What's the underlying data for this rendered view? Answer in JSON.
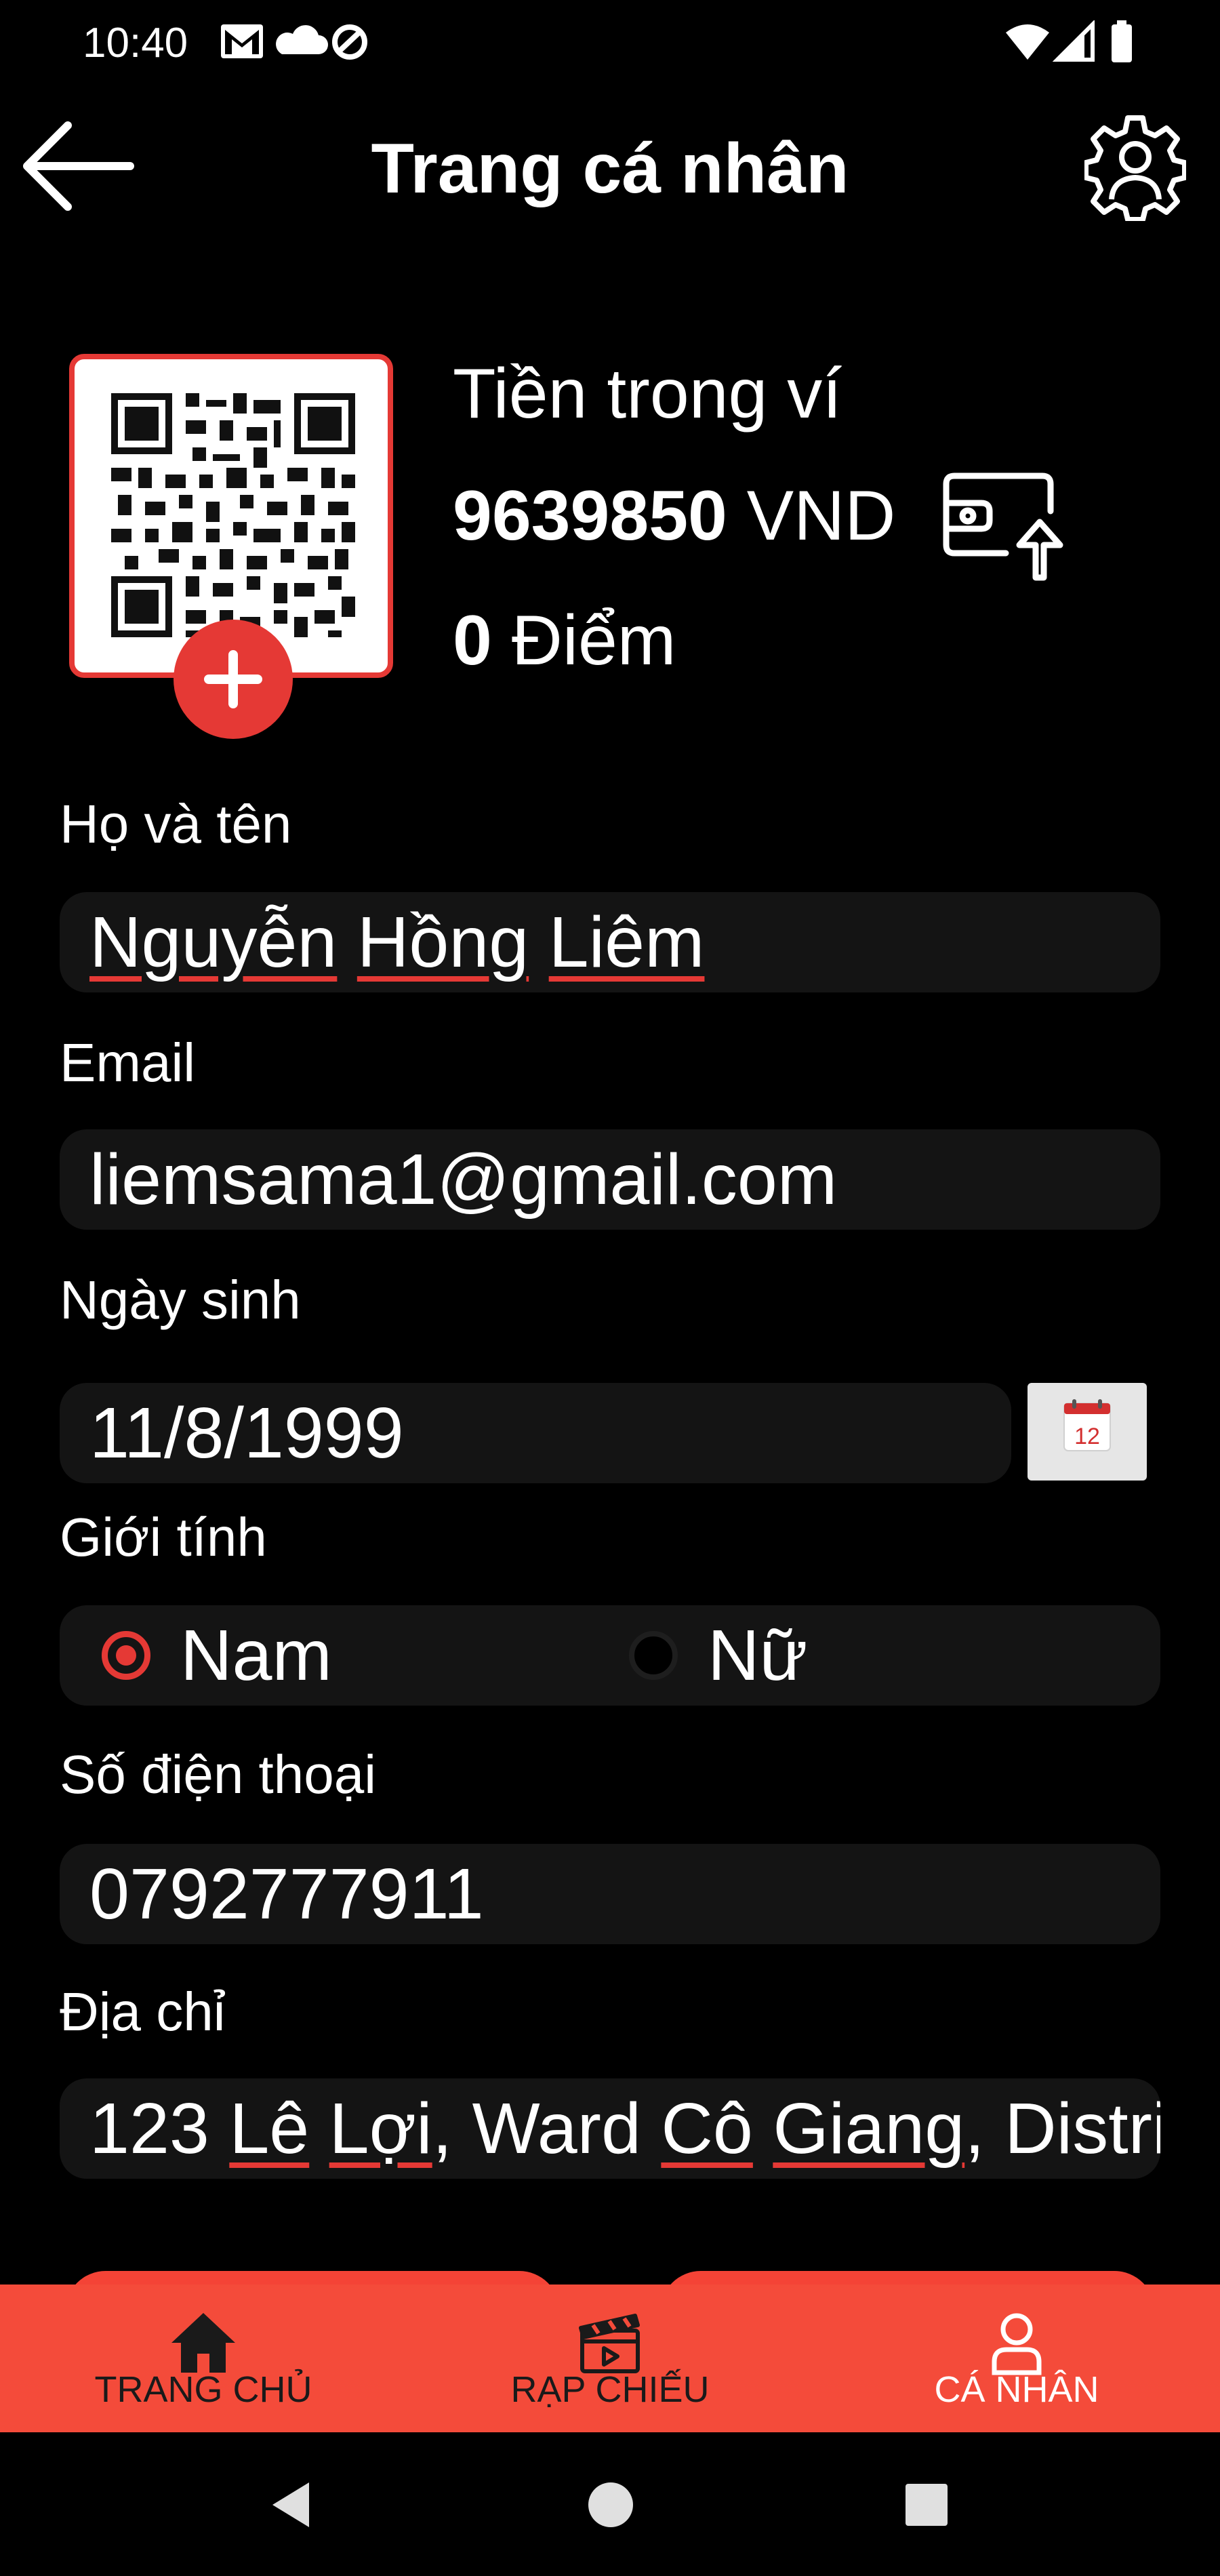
{
  "status_bar": {
    "time": "10:40",
    "left_icons": [
      "gmail-icon",
      "cloud-icon",
      "data-saver-icon"
    ],
    "right_icons": [
      "wifi-icon",
      "signal-icon",
      "battery-icon"
    ]
  },
  "header": {
    "title": "Trang cá nhân",
    "back_icon": "arrow-left-icon",
    "settings_icon": "gear-user-icon"
  },
  "profile": {
    "qr_icon": "qr-code-icon",
    "add_icon": "plus-icon",
    "wallet_label": "Tiền trong ví",
    "wallet_amount": "9639850",
    "wallet_currency": "VND",
    "wallet_topup_icon": "wallet-upload-icon",
    "points_value": "0",
    "points_label": "Điểm"
  },
  "form": {
    "name": {
      "label": "Họ và tên",
      "value_words": [
        "Nguyễn",
        "Hồng",
        "Liêm"
      ]
    },
    "email": {
      "label": "Email",
      "value": "liemsama1@gmail.com"
    },
    "birthday": {
      "label": "Ngày sinh",
      "value": "11/8/1999",
      "calendar_day": "12"
    },
    "gender": {
      "label": "Giới tính",
      "options": [
        {
          "label": "Nam",
          "selected": true
        },
        {
          "label": "Nữ",
          "selected": false
        }
      ]
    },
    "phone": {
      "label": "Số điện thoại",
      "value": "0792777911"
    },
    "address": {
      "label": "Địa chỉ",
      "value_parts": {
        "p1": "123 ",
        "w1": "Lê",
        "p2": " ",
        "w2": "Lợi",
        "p3": ", Ward ",
        "w3": "Cô",
        "p4": " ",
        "w4": "Giang",
        "p5": ", Distri"
      }
    }
  },
  "bottom_nav": {
    "items": [
      {
        "label": "TRANG CHỦ",
        "icon": "home-icon",
        "active": false
      },
      {
        "label": "RẠP CHIẾU",
        "icon": "movie-clapper-icon",
        "active": false
      },
      {
        "label": "CÁ NHÂN",
        "icon": "user-icon",
        "active": true
      }
    ],
    "background": "#f44b3a"
  },
  "colors": {
    "accent": "#e53935",
    "field_background": "#141414",
    "background": "#000000"
  }
}
